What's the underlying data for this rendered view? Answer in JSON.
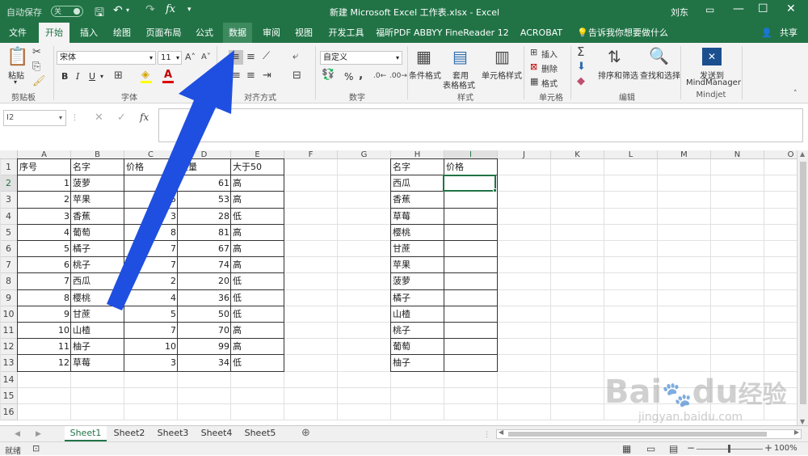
{
  "titlebar": {
    "autosave": "自动保存",
    "toggle_state": "关",
    "title": "新建 Microsoft Excel 工作表.xlsx - Excel",
    "user": "刘东"
  },
  "tabs": {
    "file": "文件",
    "home": "开始",
    "insert": "插入",
    "draw": "绘图",
    "page_layout": "页面布局",
    "formulas": "公式",
    "data": "数据",
    "review": "审阅",
    "view": "视图",
    "developer": "开发工具",
    "foxit": "福昕PDF",
    "abbyy": "ABBYY FineReader 12",
    "acrobat": "ACROBAT",
    "tell_me": "告诉我你想要做什么",
    "share": "共享"
  },
  "ribbon": {
    "paste": "粘贴",
    "clipboard": "剪贴板",
    "font_name": "宋体",
    "font_size": "11",
    "bold": "B",
    "italic": "I",
    "underline": "U",
    "font_group": "字体",
    "align_group": "对齐方式",
    "number_format": "自定义",
    "number_group": "数字",
    "percent": "%",
    "cond_format": "条件格式",
    "table_format_1": "套用",
    "table_format_2": "表格格式",
    "cell_style": "单元格样式",
    "styles_group": "样式",
    "insert": "插入",
    "delete": "删除",
    "format": "格式",
    "cells_group": "单元格",
    "sort_filter": "排序和筛选",
    "find_select": "查找和选择",
    "editing_group": "编辑",
    "mindmanager_1": "发送到",
    "mindmanager_2": "MindManager",
    "mindjet_group": "Mindjet"
  },
  "formula_bar": {
    "name_box": "I2",
    "fx": "fx",
    "value": ""
  },
  "columns": [
    "A",
    "B",
    "C",
    "D",
    "E",
    "F",
    "G",
    "H",
    "I",
    "J",
    "K",
    "L",
    "M",
    "N",
    "O"
  ],
  "rows": [
    "1",
    "2",
    "3",
    "4",
    "5",
    "6",
    "7",
    "8",
    "9",
    "10",
    "11",
    "12",
    "13",
    "14",
    "15",
    "16"
  ],
  "table1": {
    "headers": [
      "序号",
      "名字",
      "价格",
      "重量",
      "大于50"
    ],
    "data": [
      [
        "1",
        "菠萝",
        "6",
        "61",
        "高"
      ],
      [
        "2",
        "苹果",
        "5",
        "53",
        "高"
      ],
      [
        "3",
        "香蕉",
        "3",
        "28",
        "低"
      ],
      [
        "4",
        "葡萄",
        "8",
        "81",
        "高"
      ],
      [
        "5",
        "橘子",
        "7",
        "67",
        "高"
      ],
      [
        "6",
        "桃子",
        "7",
        "74",
        "高"
      ],
      [
        "7",
        "西瓜",
        "2",
        "20",
        "低"
      ],
      [
        "8",
        "樱桃",
        "4",
        "36",
        "低"
      ],
      [
        "9",
        "甘蔗",
        "5",
        "50",
        "低"
      ],
      [
        "10",
        "山楂",
        "7",
        "70",
        "高"
      ],
      [
        "11",
        "柚子",
        "10",
        "99",
        "高"
      ],
      [
        "12",
        "草莓",
        "3",
        "34",
        "低"
      ]
    ]
  },
  "table2": {
    "headers": [
      "名字",
      "价格"
    ],
    "names": [
      "西瓜",
      "香蕉",
      "草莓",
      "樱桃",
      "甘蔗",
      "苹果",
      "菠萝",
      "橘子",
      "山楂",
      "桃子",
      "葡萄",
      "柚子"
    ]
  },
  "sheets": [
    "Sheet1",
    "Sheet2",
    "Sheet3",
    "Sheet4",
    "Sheet5"
  ],
  "status": {
    "ready": "就绪",
    "zoom": "100%"
  },
  "watermark": {
    "brand": "Bai",
    "brand2": "du",
    "brand_cn": "经验",
    "url": "jingyan.baidu.com"
  },
  "colors": {
    "excel_green": "#217346",
    "arrow_blue": "#1f4fe0"
  }
}
